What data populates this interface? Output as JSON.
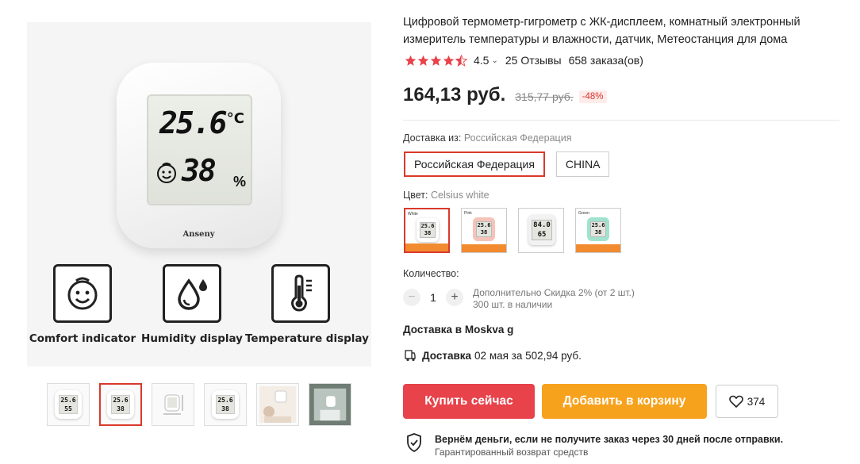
{
  "product": {
    "title": "Цифровой термометр-гигрометр с ЖК-дисплеем, комнатный электронный измеритель температуры и влажности, датчик, Метеостанция для дома",
    "rating": "4.5",
    "reviews": "25 Отзывы",
    "orders": "658 заказа(ов)",
    "price": "164,13 руб.",
    "old_price": "315,77 руб.",
    "discount": "-48%"
  },
  "main_image": {
    "lcd_temp": "25.6",
    "lcd_unit": "°C",
    "lcd_humidity": "38",
    "lcd_pct": "%",
    "brand": "Anseny",
    "features": [
      {
        "label": "Comfort indicator",
        "icon": "smiley-face-icon"
      },
      {
        "label": "Humidity display",
        "icon": "water-drop-icon"
      },
      {
        "label": "Temperature display",
        "icon": "thermometer-icon"
      }
    ]
  },
  "thumbnails": [
    {
      "line1": "25.6",
      "line2": "55"
    },
    {
      "line1": "25.6",
      "line2": "38"
    },
    {
      "line1": "",
      "line2": ""
    },
    {
      "line1": "25.6",
      "line2": "38"
    },
    {
      "line1": "",
      "line2": ""
    },
    {
      "line1": "",
      "line2": ""
    }
  ],
  "shipping": {
    "label": "Доставка из:",
    "selected_value": "Российская Федерация",
    "options": [
      "Российская Федерация",
      "CHINA"
    ]
  },
  "color": {
    "label": "Цвет:",
    "selected_value": "Celsius white",
    "swatches": [
      {
        "tag": "White",
        "line1": "25.6",
        "line2": "38",
        "bg": "#ffffff"
      },
      {
        "tag": "Pink",
        "line1": "25.6",
        "line2": "38",
        "bg": "#f6c3b8"
      },
      {
        "tag": "",
        "line1": "84.0",
        "line2": "65",
        "bg": "#f2f2f2"
      },
      {
        "tag": "Green",
        "line1": "25.6",
        "line2": "38",
        "bg": "#9fe3cf"
      }
    ]
  },
  "quantity": {
    "label": "Количество:",
    "value": "1",
    "minus": "−",
    "plus": "+",
    "discount_info": "Дополнительно Скидка 2% (от 2 шт.)",
    "stock": "300 шт. в наличии"
  },
  "delivery": {
    "to": "Доставка в Moskva g",
    "label": "Доставка",
    "detail": "02 мая за 502,94 руб."
  },
  "actions": {
    "buy_now": "Купить сейчас",
    "add_to_cart": "Добавить в корзину",
    "wishlist_count": "374"
  },
  "guarantee": {
    "line1": "Вернём деньги, если не получите заказ через 30 дней после отправки.",
    "line2": "Гарантированный возврат средств"
  },
  "colors": {
    "accent_red": "#e8424a",
    "accent_orange": "#f7a21d",
    "star": "#e8424a",
    "discount_text": "#e0332c"
  }
}
